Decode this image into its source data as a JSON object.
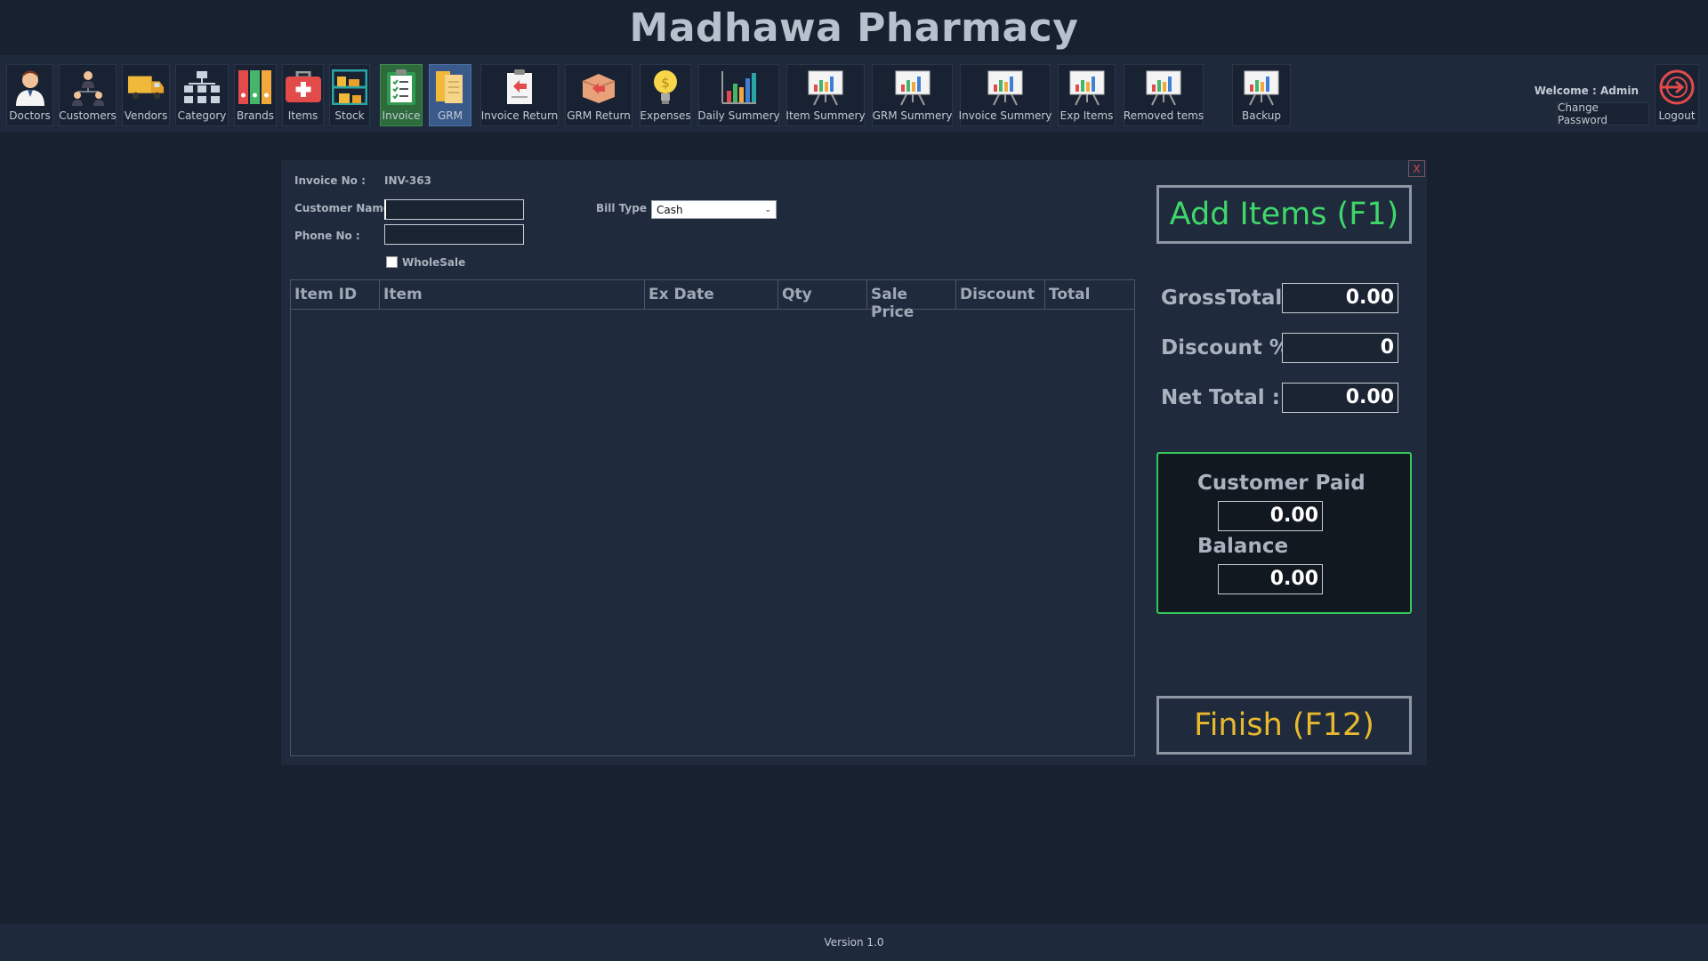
{
  "app": {
    "title": "Madhawa Pharmacy",
    "version": "Version 1.0"
  },
  "toolbar": {
    "items": [
      {
        "label": "Doctors",
        "icon": "doctor-icon"
      },
      {
        "label": "Customers",
        "icon": "customers-icon"
      },
      {
        "label": "Vendors",
        "icon": "truck-icon"
      },
      {
        "label": "Category",
        "icon": "hierarchy-icon"
      },
      {
        "label": "Brands",
        "icon": "binders-icon"
      },
      {
        "label": "Items",
        "icon": "first-aid-icon"
      },
      {
        "label": "Stock",
        "icon": "shelves-icon"
      },
      {
        "label": "Invoice",
        "icon": "clipboard-icon"
      },
      {
        "label": "GRM",
        "icon": "documents-icon"
      },
      {
        "label": "Invoice Return",
        "icon": "return-doc-icon"
      },
      {
        "label": "GRM Return",
        "icon": "return-box-icon"
      },
      {
        "label": "Expenses",
        "icon": "bulb-money-icon"
      },
      {
        "label": "Daily Summery",
        "icon": "bar-chart-icon"
      },
      {
        "label": "Item Summery",
        "icon": "board-chart-icon"
      },
      {
        "label": "GRM Summery",
        "icon": "board-chart-icon"
      },
      {
        "label": "Invoice Summery",
        "icon": "board-chart-icon"
      },
      {
        "label": "Exp Items",
        "icon": "board-chart-icon"
      },
      {
        "label": "Removed tems",
        "icon": "board-chart-icon"
      },
      {
        "label": "Backup",
        "icon": "board-chart-icon"
      },
      {
        "label": "Logout",
        "icon": "logout-icon"
      }
    ],
    "welcome": "Welcome : Admin",
    "change_password": "Change Password"
  },
  "invoice": {
    "close_label": "X",
    "invoice_no_label": "Invoice No :",
    "invoice_no": "INV-363",
    "customer_name_label": "Customer Name :",
    "customer_name": "",
    "phone_label": "Phone No :",
    "phone": "",
    "bill_type_label": "Bill Type :",
    "bill_type": "Cash",
    "wholesale_label": "WholeSale",
    "wholesale_checked": false
  },
  "grid": {
    "columns": [
      "Item ID",
      "Item",
      "Ex Date",
      "Qty",
      "Sale Price",
      "Discount",
      "Total"
    ],
    "rows": []
  },
  "totals": {
    "add_items_label": "Add Items (F1)",
    "gross_label": "GrossTotal :",
    "gross": "0.00",
    "discount_label": "Discount %",
    "discount": "0",
    "net_label": "Net Total :",
    "net": "0.00",
    "customer_paid_label": "Customer Paid",
    "customer_paid": "0.00",
    "balance_label": "Balance",
    "balance": "0.00",
    "finish_label": "Finish (F12)"
  },
  "colors": {
    "background": "#172130",
    "panel": "#1f2b3c",
    "add_items": "#3fd66a",
    "finish": "#e8b92e",
    "pay_border": "#35c95c",
    "invoice_active": "#2e6b3c",
    "grm_active": "#3a5a8c"
  }
}
